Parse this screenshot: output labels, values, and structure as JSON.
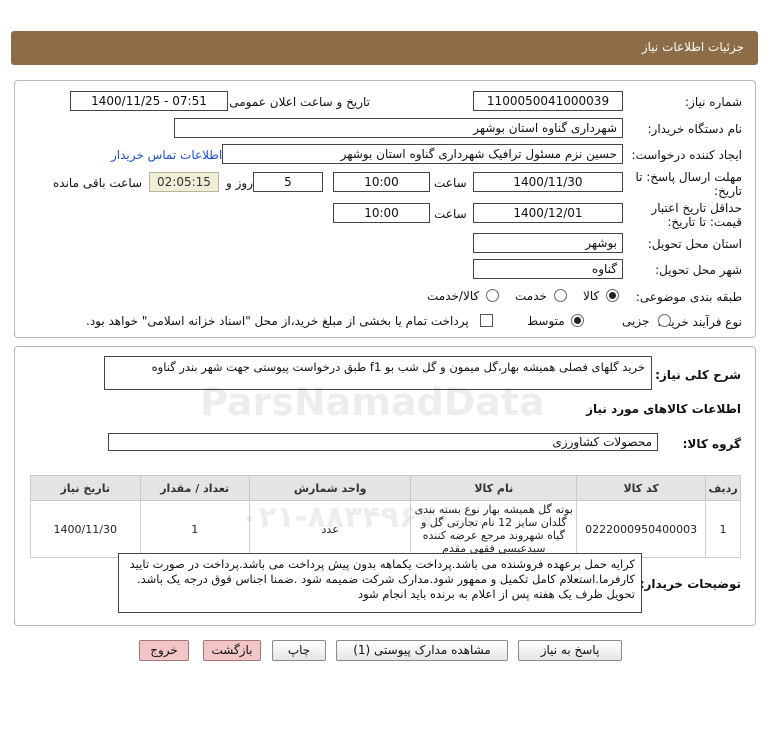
{
  "header": {
    "title": "جزئیات اطلاعات نیاز"
  },
  "form": {
    "need_number_label": "شماره نیاز:",
    "need_number": "1100050041000039",
    "announce_label": "تاریخ و ساعت اعلان عمومی:",
    "announce_value": "1400/11/25 - 07:51",
    "buyer_org_label": "نام دستگاه خریدار:",
    "buyer_org": "شهرداری گناوه استان بوشهر",
    "creator_label": "ایجاد کننده درخواست:",
    "creator": "حسین نزم مسئول ترافیک شهرداری گناوه استان بوشهر",
    "contact_link": "اطلاعات تماس خریدار",
    "deadline_label_1": "مهلت ارسال پاسخ: تا",
    "deadline_label_2": "تاریخ:",
    "deadline_date": "1400/11/30",
    "time_label": "ساعت",
    "deadline_time": "10:00",
    "days_value": "5",
    "days_label": "روز و",
    "remaining_time": "02:05:15",
    "remaining_label": "ساعت باقی مانده",
    "validity_label_1": "حداقل تاریخ اعتبار",
    "validity_label_2": "قیمت: تا تاریخ:",
    "validity_date": "1400/12/01",
    "validity_time_label": "ساعت",
    "validity_time": "10:00",
    "province_label": "استان محل تحویل:",
    "province": "بوشهر",
    "city_label": "شهر محل تحویل:",
    "city": "گناوه",
    "category_label": "طبقه بندی موضوعی:",
    "category_options": [
      "کالا",
      "خدمت",
      "کالا/خدمت"
    ],
    "process_label": "نوع فرآیند خرید :",
    "process_options": [
      "جزیی",
      "متوسط"
    ],
    "payment_note": "پرداخت تمام یا بخشی از مبلغ خرید،از محل \"اسناد خزانه اسلامی\" خواهد بود."
  },
  "summary": {
    "label": "شرح کلی نیاز:",
    "text": "خرید گلهای فصلی همیشه بهار،گل میمون و گل شب بو f1  طبق درخواست پیوستی جهت شهر بندر گناوه"
  },
  "goods": {
    "section_title": "اطلاعات کالاهای مورد نیاز",
    "group_label": "گروه کالا:",
    "group_value": "محصولات کشاورزی",
    "columns": [
      "ردیف",
      "کد کالا",
      "نام کالا",
      "واحد شمارش",
      "تعداد / مقدار",
      "تاریخ نیاز"
    ],
    "rows": [
      {
        "row": "1",
        "code": "0222000950400003",
        "name": "بوته گل همیشه بهار نوع بسته بندی گلدان سایز 12 نام تجارتی گل و گیاه شهروند مرجع عرضه کننده سیدعیسی فقهی مقدم",
        "unit": "عدد",
        "qty": "1",
        "date": "1400/11/30"
      }
    ]
  },
  "notes": {
    "label": "توضیحات خریدار:",
    "text": "کرایه حمل برعهده فروشنده می باشد.پرداخت یکماهه بدون پیش پرداخت می باشد.پرداخت در صورت تایید کارفرما.استعلام کامل تکمیل و ممهور شود.مدارک شرکت ضمیمه شود .ضمنا اجناس فوق درجه یک باشد. تحویل ظرف یک هفته پس از اعلام به برنده باید انجام شود"
  },
  "buttons": {
    "reply": "پاسخ به نیاز",
    "attachments": "مشاهده مدارک پیوستی (1)",
    "print": "چاپ",
    "back": "بازگشت",
    "exit": "خروج"
  },
  "watermark": {
    "brand": "ParsNamadData",
    "phone": "۰۲۱-۸۸۳۴۹۶۷۰"
  }
}
